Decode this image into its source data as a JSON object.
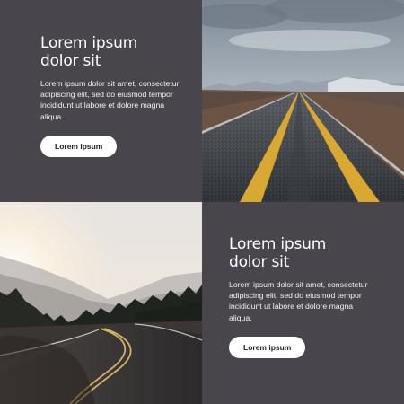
{
  "card_top": {
    "title": "Lorem ipsum\ndolor sit",
    "body": "Lorem ipsum dolor sit amet, consectetur adipiscing elit, sed do eiusmod tempor incididunt ut labore et dolore magna aliqua.",
    "button_label": "Lorem ipsum"
  },
  "card_bottom": {
    "title": "Lorem ipsum\ndolor sit",
    "body": "Lorem ipsum dolor sit amet, consectetur adipiscing elit, sed do eiusmod tempor incididunt ut labore et dolore magna aliqua.",
    "button_label": "Lorem ipsum"
  },
  "images": {
    "top_right": {
      "icon": "road-straight-yellow-lines-photo"
    },
    "bottom_left": {
      "icon": "road-curve-sunset-photo"
    }
  },
  "colors": {
    "panel_bg": "#48464c",
    "button_bg": "#ffffff",
    "road_line": "#d9a833"
  }
}
